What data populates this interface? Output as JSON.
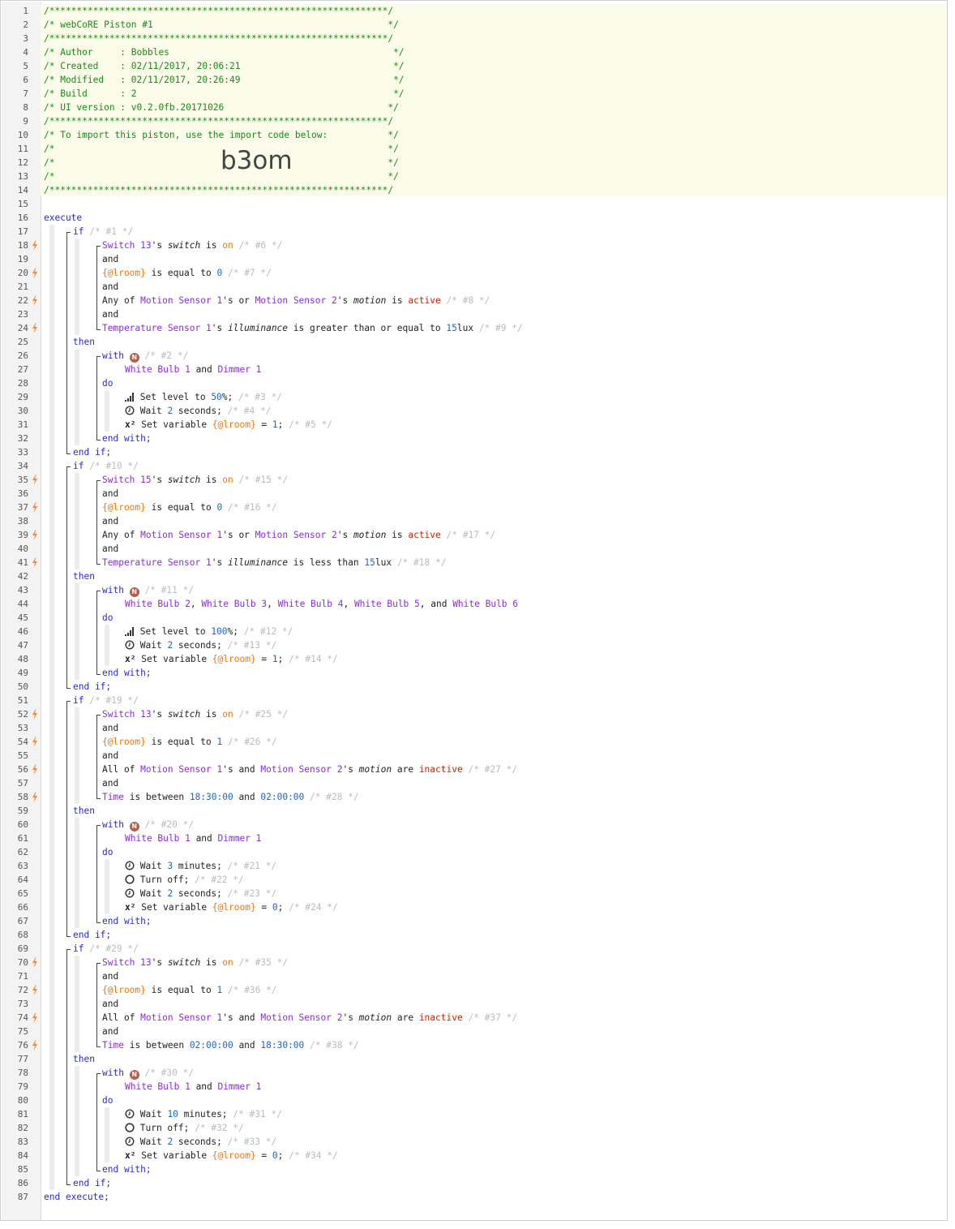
{
  "header": {
    "border_line": "/**************************************************************/",
    "title_line": "/* webCoRE Piston #1                                           */",
    "author_line": "/* Author     : Bobbles                                         */",
    "created_line": "/* Created    : 02/11/2017, 20:06:21                            */",
    "modified_line": "/* Modified   : 02/11/2017, 20:26:49                            */",
    "build_line": "/* Build      : 2                                               */",
    "ui_line": "/* UI version : v0.2.0fb.20171026                              */",
    "import_line": "/* To import this piston, use the import code below:           */",
    "blank_line": "/*                                                             */",
    "import_code": "b3om"
  },
  "keywords": {
    "execute": "execute",
    "end_execute": "end execute;",
    "if": "if",
    "then": "then",
    "end_if": "end if;",
    "and": "and",
    "with": "with",
    "do": "do",
    "end_with": "end with;",
    "n_badge": "N"
  },
  "line_numbers": [
    "1",
    "2",
    "3",
    "4",
    "5",
    "6",
    "7",
    "8",
    "9",
    "10",
    "11",
    "12",
    "13",
    "14",
    "15",
    "16",
    "17",
    "18",
    "19",
    "20",
    "21",
    "22",
    "23",
    "24",
    "25",
    "26",
    "27",
    "28",
    "29",
    "30",
    "31",
    "32",
    "33",
    "34",
    "35",
    "36",
    "37",
    "38",
    "39",
    "40",
    "41",
    "42",
    "43",
    "44",
    "45",
    "46",
    "47",
    "48",
    "49",
    "50",
    "51",
    "52",
    "53",
    "54",
    "55",
    "56",
    "57",
    "58",
    "59",
    "60",
    "61",
    "62",
    "63",
    "64",
    "65",
    "66",
    "67",
    "68",
    "69",
    "70",
    "71",
    "72",
    "73",
    "74",
    "75",
    "76",
    "77",
    "78",
    "79",
    "80",
    "81",
    "82",
    "83",
    "84",
    "85",
    "86",
    "87"
  ],
  "condition_lines": [
    18,
    20,
    22,
    24,
    35,
    37,
    39,
    41,
    52,
    54,
    56,
    58,
    70,
    72,
    74,
    76
  ],
  "blocks": [
    {
      "if_comment": "/* #1 */",
      "conditions": [
        {
          "type": "switch",
          "device": "Switch 13",
          "attr": "switch",
          "op": "is",
          "value": "on",
          "comment": "/* #6 */"
        },
        {
          "type": "var",
          "var": "{@lroom}",
          "op": "is equal to",
          "value": "0",
          "comment": "/* #7 */"
        },
        {
          "type": "motion",
          "quant": "Any",
          "d1": "Motion Sensor 1",
          "join": "or",
          "d2": "Motion Sensor 2",
          "attr": "motion",
          "op": "is",
          "value": "active",
          "comment": "/* #8 */"
        },
        {
          "type": "illum",
          "device": "Temperature Sensor 1",
          "attr": "illuminance",
          "op": "is greater than or equal to",
          "value": "15",
          "unit": "lux",
          "comment": "/* #9 */"
        }
      ],
      "with_comment": "/* #2 */",
      "devices": [
        "White Bulb 1",
        "Dimmer 1"
      ],
      "actions": [
        {
          "icon": "level",
          "pre": "Set level to ",
          "val": "50",
          "post": "%;",
          "comment": "/* #3 */"
        },
        {
          "icon": "clock",
          "pre": "Wait ",
          "val": "2",
          "post": " seconds;",
          "comment": "/* #4 */"
        },
        {
          "icon": "var",
          "pre": "Set variable ",
          "var": "{@lroom}",
          "mid": " = ",
          "val": "1",
          "post": ";",
          "comment": "/* #5 */"
        }
      ]
    },
    {
      "if_comment": "/* #10 */",
      "conditions": [
        {
          "type": "switch",
          "device": "Switch 15",
          "attr": "switch",
          "op": "is",
          "value": "on",
          "comment": "/* #15 */"
        },
        {
          "type": "var",
          "var": "{@lroom}",
          "op": "is equal to",
          "value": "0",
          "comment": "/* #16 */"
        },
        {
          "type": "motion",
          "quant": "Any",
          "d1": "Motion Sensor 1",
          "join": "or",
          "d2": "Motion Sensor 2",
          "attr": "motion",
          "op": "is",
          "value": "active",
          "comment": "/* #17 */"
        },
        {
          "type": "illum",
          "device": "Temperature Sensor 1",
          "attr": "illuminance",
          "op": "is less than",
          "value": "15",
          "unit": "lux",
          "comment": "/* #18 */"
        }
      ],
      "with_comment": "/* #11 */",
      "devices": [
        "White Bulb 2",
        "White Bulb 3",
        "White Bulb 4",
        "White Bulb 5",
        "White Bulb 6"
      ],
      "actions": [
        {
          "icon": "level",
          "pre": "Set level to ",
          "val": "100",
          "post": "%;",
          "comment": "/* #12 */"
        },
        {
          "icon": "clock",
          "pre": "Wait ",
          "val": "2",
          "post": " seconds;",
          "comment": "/* #13 */"
        },
        {
          "icon": "var",
          "pre": "Set variable ",
          "var": "{@lroom}",
          "mid": " = ",
          "val": "1",
          "post": ";",
          "comment": "/* #14 */"
        }
      ]
    },
    {
      "if_comment": "/* #19 */",
      "conditions": [
        {
          "type": "switch",
          "device": "Switch 13",
          "attr": "switch",
          "op": "is",
          "value": "on",
          "comment": "/* #25 */"
        },
        {
          "type": "var",
          "var": "{@lroom}",
          "op": "is equal to",
          "value": "1",
          "comment": "/* #26 */"
        },
        {
          "type": "motion",
          "quant": "All",
          "d1": "Motion Sensor 1",
          "join": "and",
          "d2": "Motion Sensor 2",
          "attr": "motion",
          "op": "are",
          "value": "inactive",
          "comment": "/* #27 */"
        },
        {
          "type": "time",
          "label": "Time",
          "op": "is between",
          "t1": "18:30:00",
          "t2": "02:00:00",
          "comment": "/* #28 */"
        }
      ],
      "with_comment": "/* #20 */",
      "devices": [
        "White Bulb 1",
        "Dimmer 1"
      ],
      "actions": [
        {
          "icon": "clock",
          "pre": "Wait ",
          "val": "3",
          "post": " minutes;",
          "comment": "/* #21 */"
        },
        {
          "icon": "power",
          "pre": "Turn off;",
          "comment": "/* #22 */"
        },
        {
          "icon": "clock",
          "pre": "Wait ",
          "val": "2",
          "post": " seconds;",
          "comment": "/* #23 */"
        },
        {
          "icon": "var",
          "pre": "Set variable ",
          "var": "{@lroom}",
          "mid": " = ",
          "val": "0",
          "post": ";",
          "comment": "/* #24 */"
        }
      ]
    },
    {
      "if_comment": "/* #29 */",
      "conditions": [
        {
          "type": "switch",
          "device": "Switch 13",
          "attr": "switch",
          "op": "is",
          "value": "on",
          "comment": "/* #35 */"
        },
        {
          "type": "var",
          "var": "{@lroom}",
          "op": "is equal to",
          "value": "1",
          "comment": "/* #36 */"
        },
        {
          "type": "motion",
          "quant": "All",
          "d1": "Motion Sensor 1",
          "join": "and",
          "d2": "Motion Sensor 2",
          "attr": "motion",
          "op": "are",
          "value": "inactive",
          "comment": "/* #37 */"
        },
        {
          "type": "time",
          "label": "Time",
          "op": "is between",
          "t1": "02:00:00",
          "t2": "18:30:00",
          "comment": "/* #38 */"
        }
      ],
      "with_comment": "/* #30 */",
      "devices": [
        "White Bulb 1",
        "Dimmer 1"
      ],
      "actions": [
        {
          "icon": "clock",
          "pre": "Wait ",
          "val": "10",
          "post": " minutes;",
          "comment": "/* #31 */"
        },
        {
          "icon": "power",
          "pre": "Turn off;",
          "comment": "/* #32 */"
        },
        {
          "icon": "clock",
          "pre": "Wait ",
          "val": "2",
          "post": " seconds;",
          "comment": "/* #33 */"
        },
        {
          "icon": "var",
          "pre": "Set variable ",
          "var": "{@lroom}",
          "mid": " = ",
          "val": "0",
          "post": ";",
          "comment": "/* #34 */"
        }
      ]
    }
  ]
}
